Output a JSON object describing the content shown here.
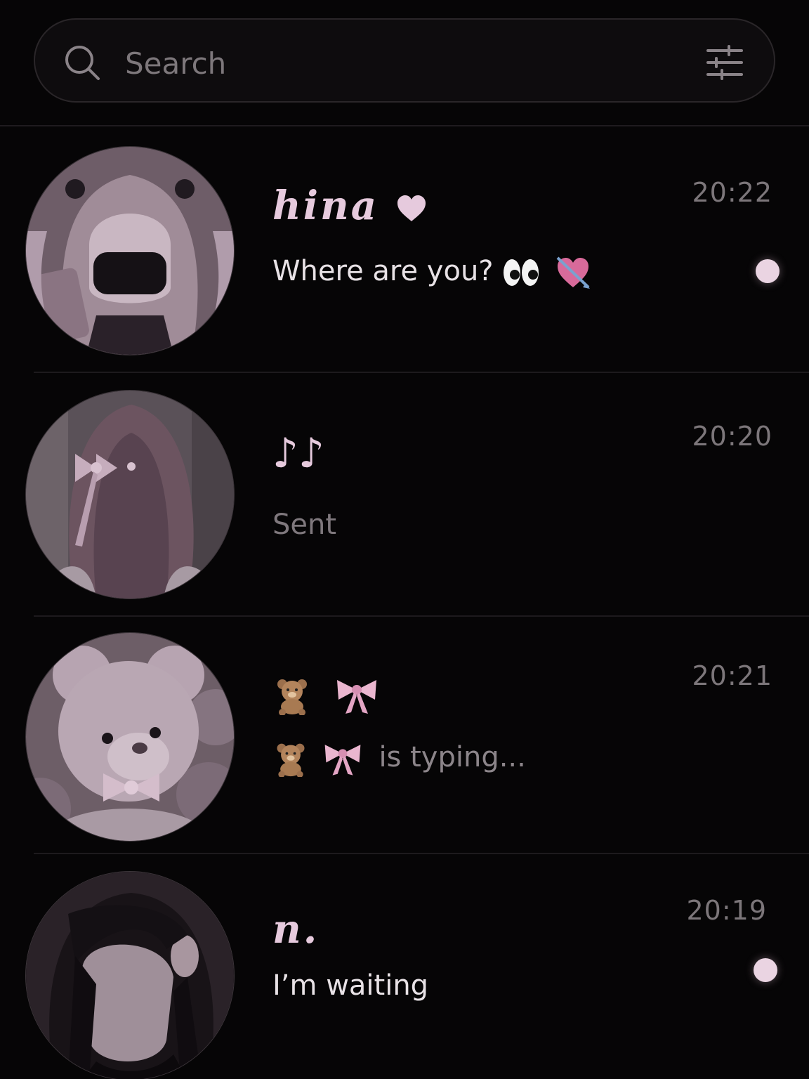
{
  "search": {
    "placeholder": "Search",
    "icon": "search-icon",
    "filter_icon": "sliders-icon"
  },
  "chats": [
    {
      "name": "hina",
      "name_icon": "heart-icon",
      "preview": "Where are you? ",
      "preview_icons": [
        "eyes-icon",
        "heart-with-arrow-icon"
      ],
      "time": "20:22",
      "unread": true,
      "avatar": "avatar-girl-mask"
    },
    {
      "name": "♪♪",
      "preview": "Sent",
      "time": "20:20",
      "unread": false,
      "avatar": "avatar-girl-ribbon"
    },
    {
      "name_icons": [
        "teddy-bear-icon",
        "ribbon-icon"
      ],
      "preview": "is typing...",
      "preview_icons": [
        "teddy-bear-icon",
        "ribbon-icon"
      ],
      "time": "20:21",
      "unread": false,
      "avatar": "avatar-teddy-bear"
    },
    {
      "name": "n.",
      "preview": "I’m waiting",
      "time": "20:19",
      "unread": true,
      "avatar": "avatar-dark-hair"
    }
  ],
  "colors": {
    "background": "#060506",
    "accent_pink": "#e6cadd",
    "unread_dot": "#ead4e2",
    "muted_text": "#7c767a"
  }
}
